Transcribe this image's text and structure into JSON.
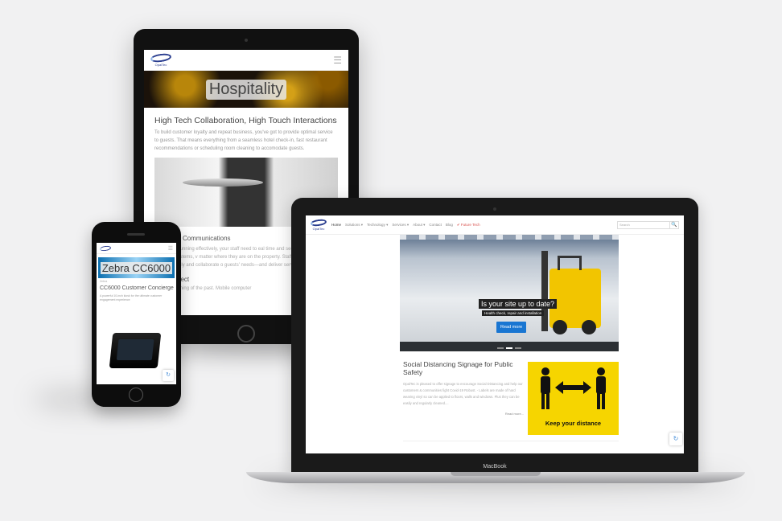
{
  "tablet": {
    "logo_text": "OpalTec",
    "hero_title": "Hospitality",
    "section1_title": "High Tech Collaboration, High Touch Interactions",
    "section1_body": "To build customer loyalty and repeat business, you've got to provide optimal service to guests. That means everything from a seamless hotel check-in, fast restaurant recommendations or scheduling room cleaning to accomodate guests.",
    "section2_title": "ality Staff Communications",
    "section2_body": "operations running effectively, your staff need to eal time and securely access business systems, v matter where they are on the property. Staff co nable everyone to move freely and collaborate o guests' needs—and deliver service that make",
    "section3_title": "rce Connect",
    "section3_body": "ie talkies a thing of the past. Mobile computer"
  },
  "laptop": {
    "brand_label": "MacBook",
    "logo_text": "OpalTec",
    "menu": [
      "Home",
      "Solutions ▾",
      "Technology ▾",
      "Services ▾",
      "About ▾",
      "Contact",
      "Blog",
      "✔ Future Tech"
    ],
    "search_placeholder": "Search",
    "search_button": "🔍",
    "hero_title": "Is your site up to date?",
    "hero_subtitle": "Health check, repair and installation",
    "hero_button": "Read more",
    "post_title": "Social Distancing Signage for Public Safety",
    "post_body": "OpalTec is pleased to offer signage to encourage Social Distancing and help our customers & communities fight Covid-19 Robust. - Labels are made of hard wearing vinyl so can be applied to floors, walls and windows. Plus they can be easily and regularly cleaned....",
    "post_more": "Read more...",
    "sign_text": "Keep your distance"
  },
  "phone": {
    "logo_text": "OpalTec",
    "hero_title": "Zebra CC6000",
    "breadcrumb": "Zebra",
    "product_title": "CC6000 Customer Concierge",
    "product_desc": "A powerful 10-inch kiosk for the ultimate customer engagement experience"
  },
  "colors": {
    "accent_blue": "#1976d2",
    "sign_yellow": "#f6d500",
    "future_red": "#d9534f"
  }
}
